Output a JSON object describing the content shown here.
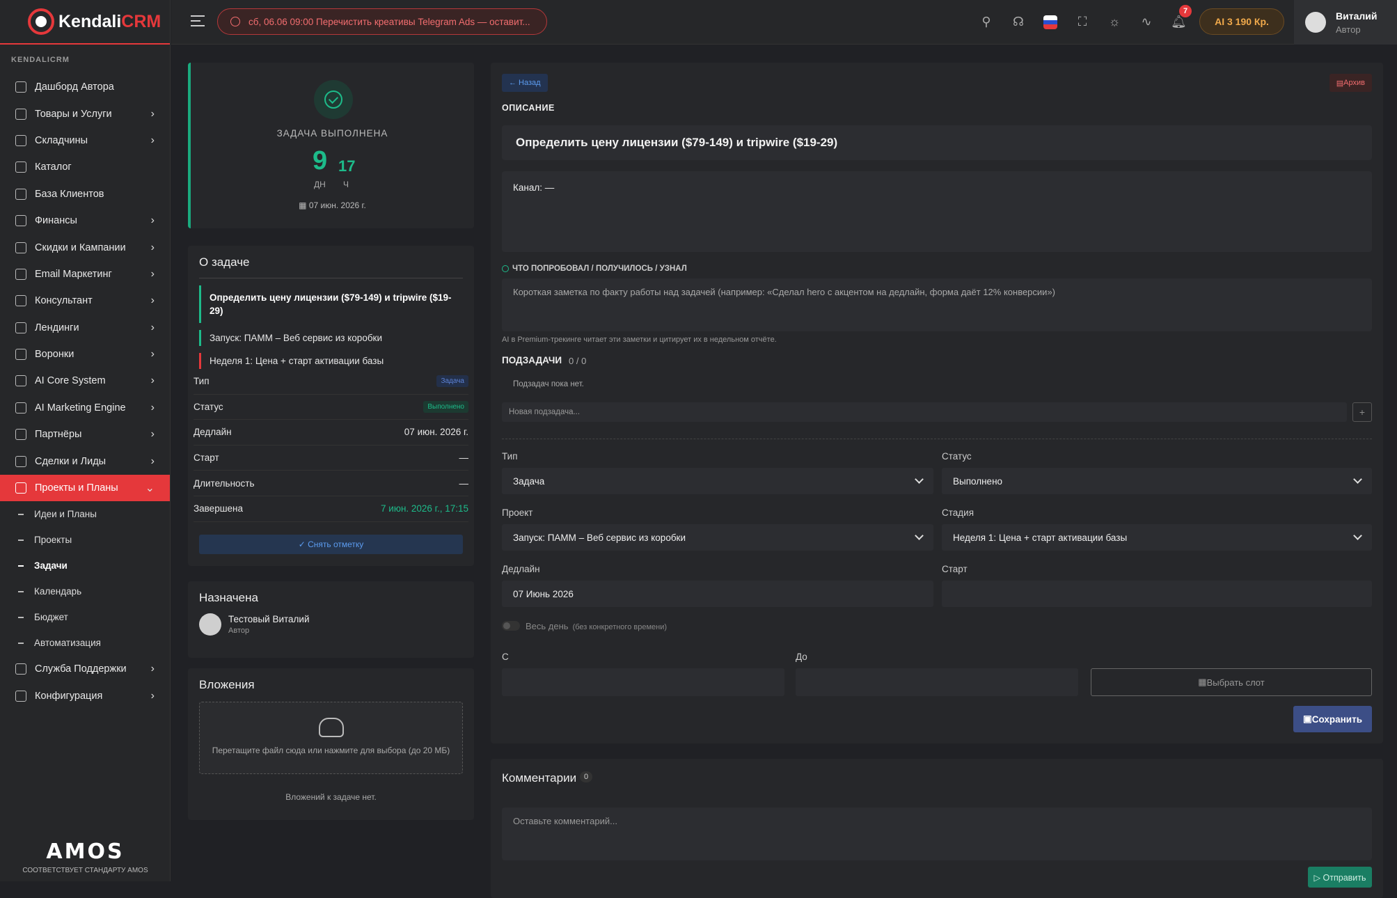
{
  "brand": {
    "name_a": "Kendali",
    "name_b": "CRM",
    "section": "KENDALICRM"
  },
  "sidebar": {
    "items": [
      {
        "label": "Дашборд Автора"
      },
      {
        "label": "Товары и Услуги"
      },
      {
        "label": "Складчины"
      },
      {
        "label": "Каталог"
      },
      {
        "label": "База Клиентов"
      },
      {
        "label": "Финансы"
      },
      {
        "label": "Скидки и Кампании"
      },
      {
        "label": "Email Маркетинг"
      },
      {
        "label": "Консультант"
      },
      {
        "label": "Лендинги"
      },
      {
        "label": "Воронки"
      },
      {
        "label": "AI Core System"
      },
      {
        "label": "AI Marketing Engine"
      },
      {
        "label": "Партнёры"
      },
      {
        "label": "Сделки и Лиды"
      },
      {
        "label": "Проекты и Планы"
      },
      {
        "label": "Служба Поддержки"
      },
      {
        "label": "Конфигурация"
      }
    ],
    "subitems": [
      {
        "label": "Идеи и Планы"
      },
      {
        "label": "Проекты"
      },
      {
        "label": "Задачи"
      },
      {
        "label": "Календарь"
      },
      {
        "label": "Бюджет"
      },
      {
        "label": "Автоматизация"
      }
    ],
    "footer_logo": "AMOS",
    "footer_text": "СООТВЕТСТВУЕТ СТАНДАРТУ AMOS"
  },
  "topbar": {
    "reminder": "сб, 06.06 09:00  Перечистить креативы Telegram Ads — оставит...",
    "notifications_count": "7",
    "ai_balance": "AI 3 190 Кр.",
    "user_name": "Виталий",
    "user_role": "Автор",
    "icons": [
      "map-pin-icon",
      "headset-icon",
      "flag-icon",
      "fullscreen-icon",
      "sun-icon",
      "activity-icon",
      "bell-icon"
    ]
  },
  "done": {
    "title": "ЗАДАЧА ВЫПОЛНЕНА",
    "days": "9",
    "days_unit": "ДН",
    "hours": "17",
    "hours_unit": "Ч",
    "date": "07 июн. 2026 г."
  },
  "about": {
    "title": "О задаче",
    "task": "Определить цену лицензии ($79-149) и tripwire ($19-29)",
    "project": "Запуск: ПАММ – Веб сервис из коробки",
    "stage": "Неделя 1: Цена + старт активации базы",
    "rows": [
      {
        "k": "Тип",
        "v": "Задача"
      },
      {
        "k": "Статус",
        "v": "Выполнено"
      },
      {
        "k": "Дедлайн",
        "v": "07 июн. 2026 г."
      },
      {
        "k": "Старт",
        "v": "—"
      },
      {
        "k": "Длительность",
        "v": "—"
      },
      {
        "k": "Завершена",
        "v": "7 июн. 2026 г., 17:15"
      }
    ],
    "unmark": "✓ Снять отметку"
  },
  "assigned": {
    "title": "Назначена",
    "name": "Тестовый Виталий",
    "role": "Автор"
  },
  "attachments": {
    "title": "Вложения",
    "drop": "Перетащите файл сюда или нажмите для выбора (до 20 МБ)",
    "empty": "Вложений к задаче нет."
  },
  "main": {
    "back": "← Назад",
    "archive": "Архив",
    "desc_label": "ОПИСАНИЕ",
    "title": "Определить цену лицензии ($79-149) и tripwire ($19-29)",
    "description": "Канал: —",
    "notes_label": "ЧТО ПОПРОБОВАЛ / ПОЛУЧИЛОСЬ / УЗНАЛ",
    "notes_placeholder": "Короткая заметка по факту работы над задачей (например: «Сделал hero с акцентом на дедлайн, форма даёт 12% конверсии»)",
    "notes_hint": "AI в Premium-трекинге читает эти заметки и цитирует их в недельном отчёте.",
    "subtasks_label": "ПОДЗАДАЧИ",
    "subtasks_count": "0 / 0",
    "no_subtasks": "Подзадач пока нет.",
    "new_subtask": "Новая подзадача...",
    "type_label": "Тип",
    "type_value": "Задача",
    "status_label": "Статус",
    "status_value": "Выполнено",
    "project_label": "Проект",
    "project_value": "Запуск: ПАММ – Веб сервис из коробки",
    "stage_label": "Стадия",
    "stage_value": "Неделя 1: Цена + старт активации базы",
    "deadline_label": "Дедлайн",
    "deadline_value": "07 Июнь 2026",
    "start_label": "Старт",
    "start_value": "",
    "allday_label": "Весь день",
    "allday_hint": "(без конкретного времени)",
    "from_label": "С",
    "to_label": "До",
    "slot": "Выбрать слот",
    "save": "Сохранить"
  },
  "comments": {
    "title": "Комментарии",
    "count": "0",
    "placeholder": "Оставьте комментарий...",
    "send": "▷ Отправить"
  },
  "colors": {
    "accent": "#e5383b",
    "success": "#1dbb8a",
    "primary": "#3c4e86"
  }
}
